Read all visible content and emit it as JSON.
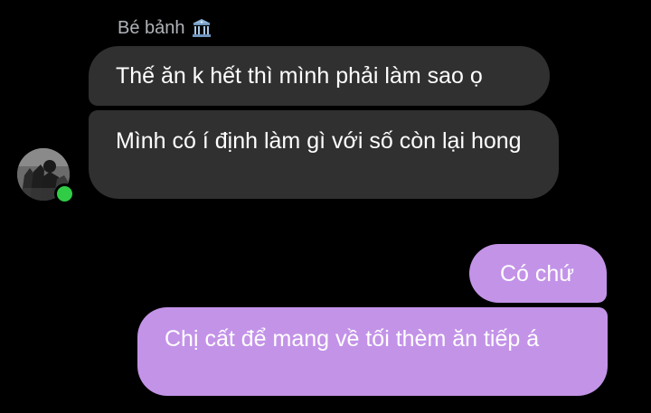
{
  "chat": {
    "sender_name": "Bé bảnh",
    "sender_badge_icon": "bank-building-icon",
    "avatar_icon": "contact-avatar",
    "status_color": "#31cc46",
    "colors": {
      "incoming_bubble": "#303030",
      "outgoing_bubble": "#c393e8",
      "background": "#000000"
    },
    "messages": [
      {
        "direction": "incoming",
        "text": "Thế ăn k hết thì mình phải làm sao ọ"
      },
      {
        "direction": "incoming",
        "text": "Mình có í định làm gì với số còn lại hong"
      },
      {
        "direction": "outgoing",
        "text": "Có chứ"
      },
      {
        "direction": "outgoing",
        "text": "Chị cất để mang về tối thèm ăn tiếp á"
      }
    ]
  }
}
